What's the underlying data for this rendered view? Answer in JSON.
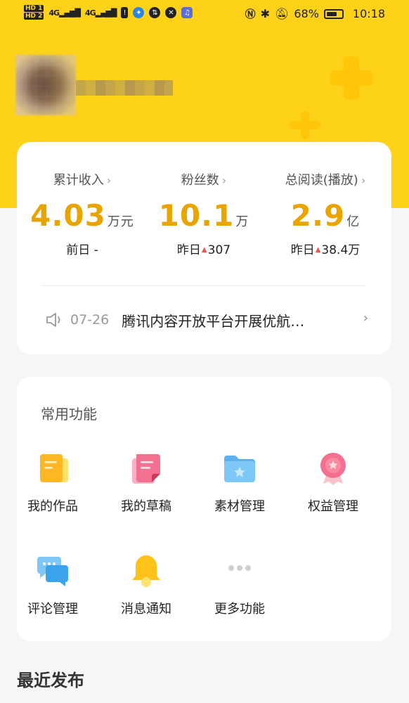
{
  "status": {
    "time": "10:18",
    "battery": "68%",
    "battery_level": 0.68,
    "network": "4G"
  },
  "stats": [
    {
      "label": "累计收入",
      "value": "4.03",
      "unit": "万元",
      "sub": "前日 -"
    },
    {
      "label": "粉丝数",
      "value": "10.1",
      "unit": "万",
      "sub_prefix": "昨日",
      "sub_value": "307"
    },
    {
      "label": "总阅读(播放)",
      "value": "2.9",
      "unit": "亿",
      "sub_prefix": "昨日",
      "sub_value": "38.4万"
    }
  ],
  "notice": {
    "date": "07-26",
    "text": "腾讯内容开放平台开展优航…"
  },
  "functions": {
    "title": "常用功能",
    "items": [
      {
        "label": "我的作品",
        "icon": "works-icon"
      },
      {
        "label": "我的草稿",
        "icon": "drafts-icon"
      },
      {
        "label": "素材管理",
        "icon": "folder-icon"
      },
      {
        "label": "权益管理",
        "icon": "badge-icon"
      },
      {
        "label": "评论管理",
        "icon": "comment-icon"
      },
      {
        "label": "消息通知",
        "icon": "bell-icon"
      },
      {
        "label": "更多功能",
        "icon": "more-icon"
      }
    ]
  },
  "recent": {
    "title": "最近发布"
  }
}
